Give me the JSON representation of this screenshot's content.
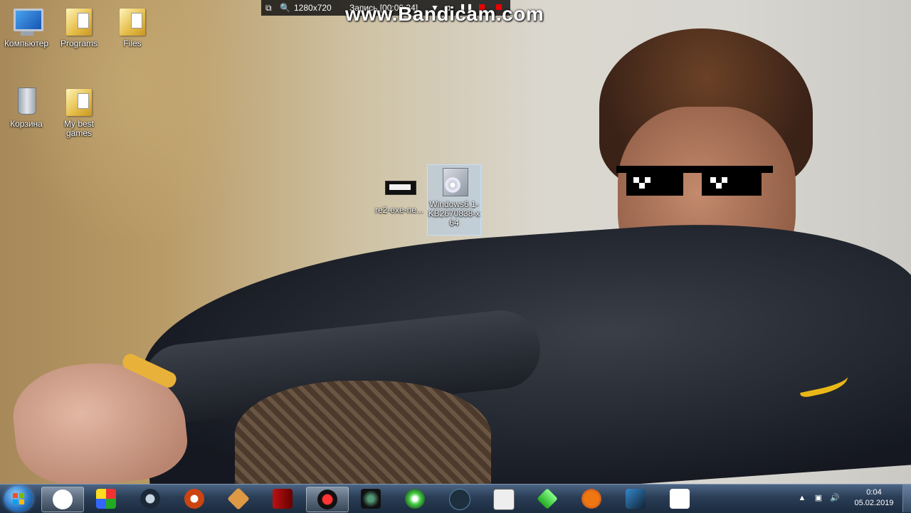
{
  "recorder": {
    "resolution": "1280x720",
    "status": "Запись [00:00:34]",
    "watermark": "www.Bandicam.com"
  },
  "desktop_icons": [
    {
      "label": "Компьютер",
      "icon": "computer-icon"
    },
    {
      "label": "Programs",
      "icon": "folder-icon"
    },
    {
      "label": "Files",
      "icon": "folder-icon"
    },
    {
      "label": "Корзина",
      "icon": "recycle-bin-icon"
    },
    {
      "label": "My best games",
      "icon": "folder-icon"
    },
    {
      "label": "re2-exe-ne...",
      "icon": "exe-icon"
    },
    {
      "label": "Windows6.1-KB2670838-x64",
      "icon": "installer-package-icon",
      "selected": true
    }
  ],
  "taskbar": {
    "pinned": [
      {
        "name": "yandex-browser",
        "icon": "yandex-icon",
        "active": true
      },
      {
        "name": "rubiks-cube",
        "icon": "rubiks-cube-icon"
      },
      {
        "name": "steam",
        "icon": "steam-icon"
      },
      {
        "name": "world-of-tanks",
        "icon": "wot-icon"
      },
      {
        "name": "star-app",
        "icon": "star-icon"
      },
      {
        "name": "red-game",
        "icon": "red-game-icon"
      },
      {
        "name": "bandicam",
        "icon": "bandicam-icon",
        "active": true
      },
      {
        "name": "alien-game",
        "icon": "alien-icon"
      },
      {
        "name": "green-disc-app",
        "icon": "green-disc-icon"
      },
      {
        "name": "nox",
        "icon": "nox-icon"
      },
      {
        "name": "notepad-app",
        "icon": "notepad-icon"
      },
      {
        "name": "sims",
        "icon": "sims-icon"
      },
      {
        "name": "basketball-game",
        "icon": "basketball-icon"
      },
      {
        "name": "game-cover",
        "icon": "game-cover-icon"
      },
      {
        "name": "anarchy-app",
        "icon": "anarchy-icon"
      }
    ],
    "tray": {
      "icons": [
        "chevron-up-icon",
        "network-icon",
        "volume-icon"
      ],
      "time": "0:04",
      "date": "05.02.2019"
    }
  },
  "colors": {
    "taskbar": "#2a3d56",
    "selection": "#aacdf5",
    "wallpaper_left": "#b99b67",
    "wallpaper_right": "#d8d6d0"
  }
}
